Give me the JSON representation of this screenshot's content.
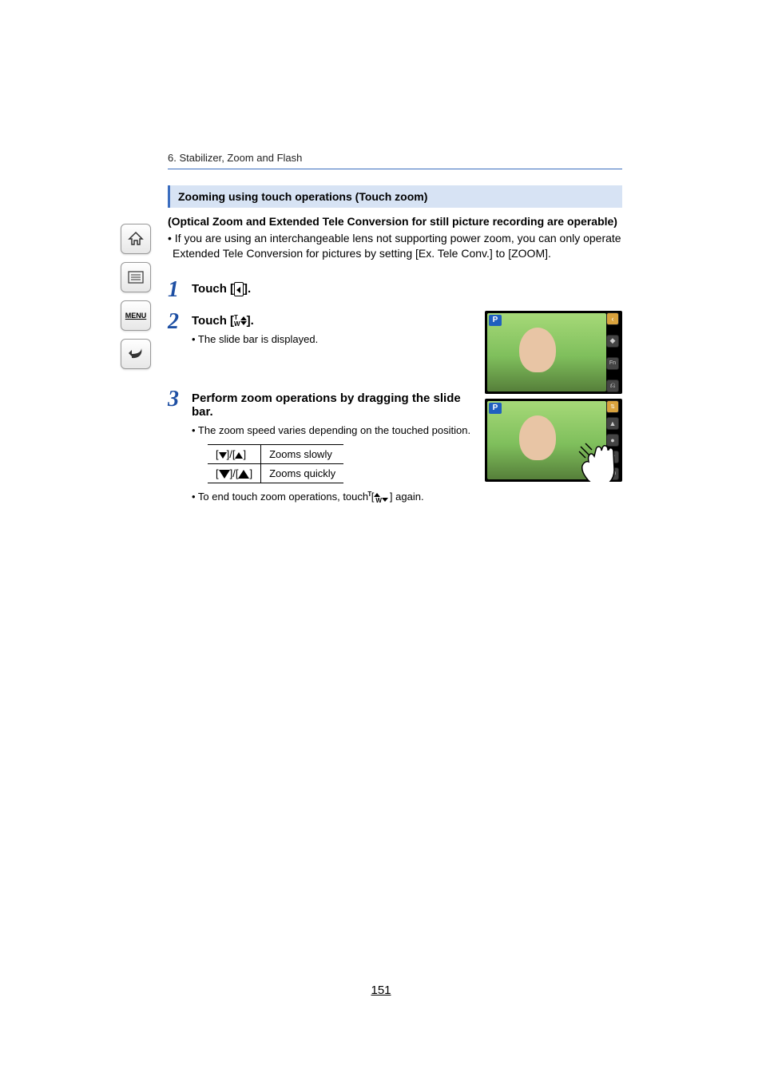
{
  "breadcrumb": "6. Stabilizer, Zoom and Flash",
  "section_title": "Zooming using touch operations (Touch zoom)",
  "intro_bold": "(Optical Zoom and Extended Tele Conversion for still picture recording are operable)",
  "intro_bullet": "• If you are using an interchangeable lens not supporting power zoom, you can only operate Extended Tele Conversion for pictures by setting [Ex. Tele Conv.] to [ZOOM].",
  "step1": {
    "title_pre": "Touch [",
    "title_post": "]."
  },
  "step2": {
    "title_pre": "Touch [",
    "title_post": "].",
    "sub": "• The slide bar is displayed."
  },
  "step3": {
    "title": "Perform zoom operations by dragging the slide bar.",
    "sub": "• The zoom speed varies depending on the touched position.",
    "table": {
      "row1": "Zooms slowly",
      "row2": "Zooms quickly"
    },
    "footer_pre": "• To end touch zoom operations, touch [",
    "footer_post": "] again."
  },
  "page_number": "151",
  "preview_mode": "P",
  "sidebar_labels": {
    "home": "home-icon",
    "list": "list-icon",
    "menu": "MENU",
    "back": "back-icon"
  }
}
